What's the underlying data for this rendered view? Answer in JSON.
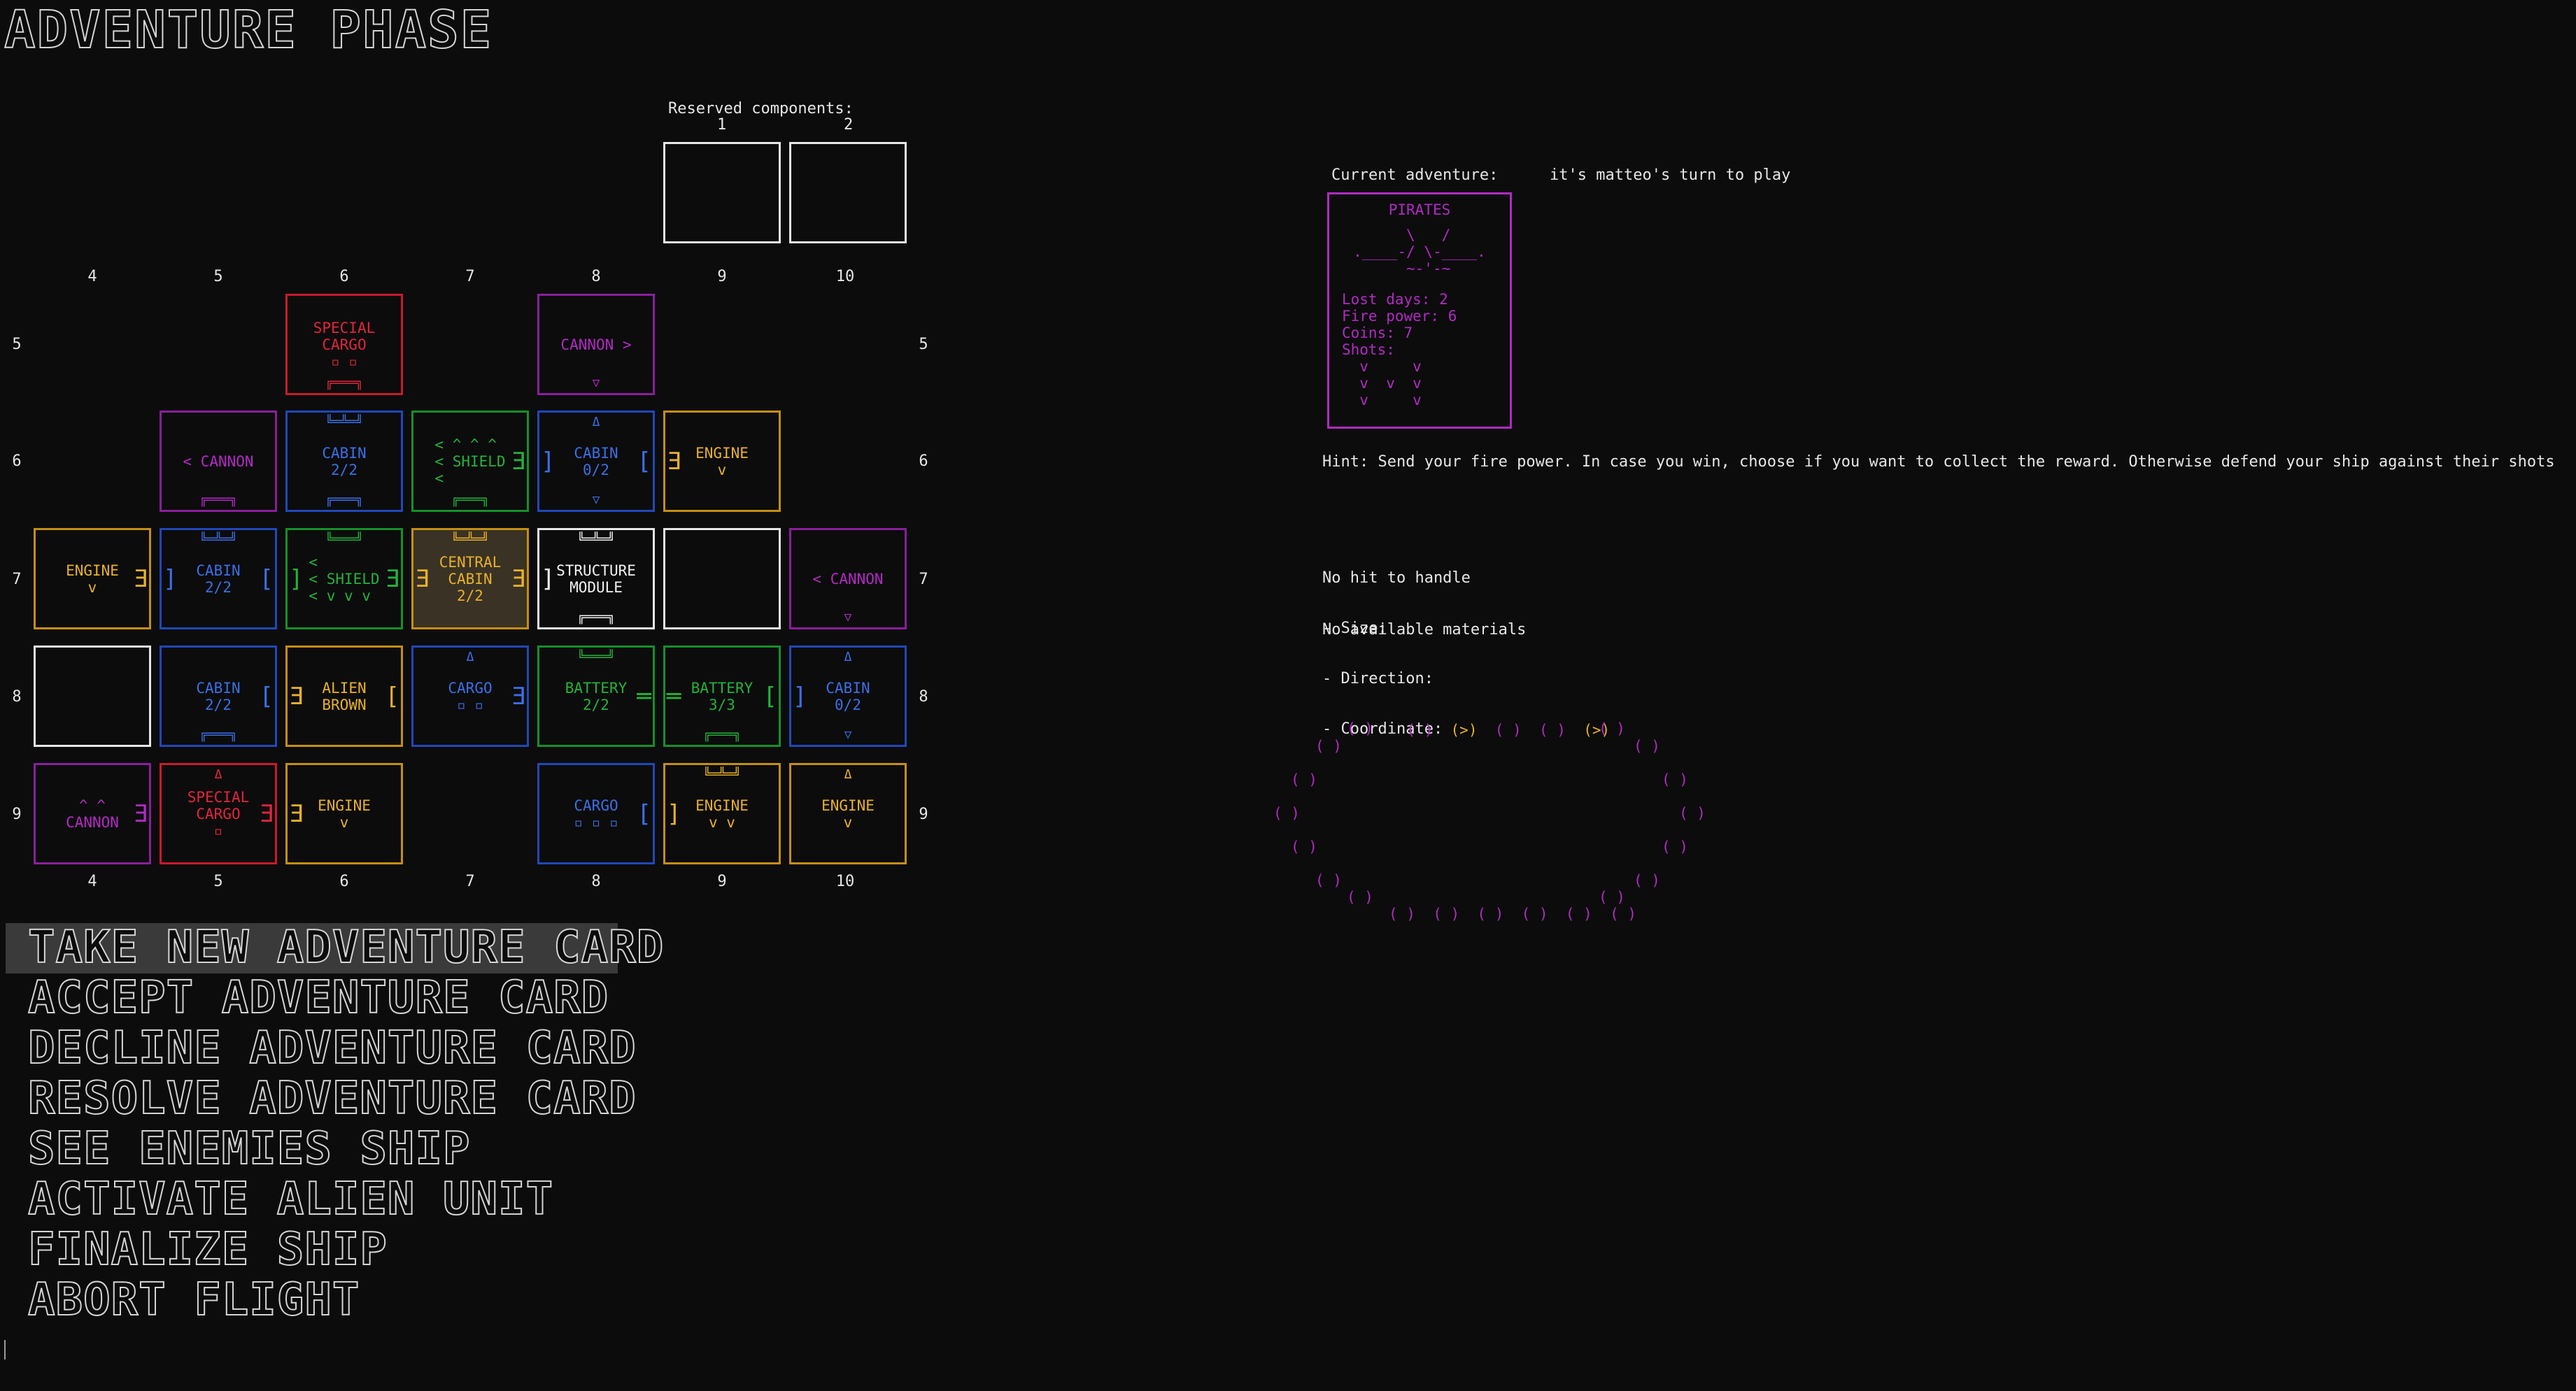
{
  "title": "ADVENTURE PHASE",
  "reserved": {
    "label": "Reserved components:",
    "slots": [
      "1",
      "2"
    ]
  },
  "grid": {
    "columns": [
      "4",
      "5",
      "6",
      "7",
      "8",
      "9",
      "10"
    ],
    "rows": [
      "5",
      "6",
      "7",
      "8",
      "9"
    ],
    "tiles": {
      "r5c6": {
        "lines": [
          "SPECIAL",
          "CARGO",
          "▫ ▫"
        ],
        "bot": "╔═══╗"
      },
      "r5c8": {
        "lines": [
          "CANNON >"
        ],
        "bot": "▽"
      },
      "r6c5": {
        "lines": [
          "< CANNON"
        ],
        "bot": "╔═══╗"
      },
      "r6c6": {
        "lines": [
          "CABIN",
          "2/2"
        ],
        "top": "╚═╩═╝",
        "bot": "╔═══╗"
      },
      "r6c7": {
        "lines": [
          "< ^ ^ ^",
          "< SHIELD",
          "<"
        ],
        "bot": "╔═══╗"
      },
      "r6c8": {
        "lines": [
          "CABIN",
          "0/2"
        ],
        "top": "Δ",
        "bot": "▽"
      },
      "r6c9": {
        "lines": [
          "ENGINE",
          "v"
        ]
      },
      "r7c4": {
        "lines": [
          "ENGINE",
          "v"
        ]
      },
      "r7c5": {
        "lines": [
          "CABIN",
          "2/2"
        ],
        "top": "╚═╩═╝"
      },
      "r7c6": {
        "lines": [
          "<",
          "< SHIELD",
          "< v v v"
        ],
        "top": "╚═══╝"
      },
      "r7c7": {
        "lines": [
          "CENTRAL",
          "CABIN",
          "2/2"
        ],
        "top": "╚═╩═╝"
      },
      "r7c8": {
        "lines": [
          "STRUCTURE",
          "MODULE"
        ],
        "top": "╚═╩═╝",
        "bot": "╔═══╗"
      },
      "r7c10": {
        "lines": [
          "< CANNON"
        ],
        "bot": "▽"
      },
      "r8c5": {
        "lines": [
          "CABIN",
          "2/2"
        ],
        "bot": "╔═══╗"
      },
      "r8c6": {
        "lines": [
          "ALIEN",
          "BROWN"
        ]
      },
      "r8c7": {
        "lines": [
          "CARGO",
          "▫ ▫"
        ],
        "top": "Δ"
      },
      "r8c8": {
        "lines": [
          "BATTERY",
          "2/2"
        ],
        "top": "╚═══╝"
      },
      "r8c9": {
        "lines": [
          "BATTERY",
          "3/3"
        ],
        "bot": "╔═══╗"
      },
      "r8c10": {
        "lines": [
          "CABIN",
          "0/2"
        ],
        "top": "Δ",
        "bot": "▽"
      },
      "r9c4": {
        "lines": [
          "^ ^",
          "CANNON"
        ]
      },
      "r9c5": {
        "lines": [
          "SPECIAL",
          "CARGO",
          "▫"
        ],
        "top": "Δ"
      },
      "r9c6": {
        "lines": [
          "ENGINE",
          "v"
        ]
      },
      "r9c8": {
        "lines": [
          "CARGO",
          "▫ ▫ ▫"
        ]
      },
      "r9c9": {
        "lines": [
          "ENGINE",
          "v v"
        ],
        "top": "╚═╩═╝"
      },
      "r9c10": {
        "lines": [
          "ENGINE",
          "v"
        ],
        "top": "Δ"
      }
    }
  },
  "adventure": {
    "current_label": "Current adventure:",
    "turn": "it's matteo's turn to play",
    "card_title": "PIRATES",
    "card_art": "  \\   /\n.____-/ \\-____.\n  ~-'-~",
    "stats": [
      "Lost days: 2",
      "Fire power: 6",
      "Coins: 7",
      "Shots:"
    ],
    "shots_art": "  v     v\n  v  v  v\n  v     v"
  },
  "hint": "Hint: Send your fire power. In case you win, choose if you want to collect the reward. Otherwise defend your ship against their shots",
  "hit_info": [
    "No hit to handle",
    "- Size:",
    "- Direction:",
    "- Coordinate:"
  ],
  "materials": "No available materials",
  "menu": [
    "TAKE NEW ADVENTURE CARD",
    "ACCEPT ADVENTURE CARD",
    "DECLINE ADVENTURE CARD",
    "RESOLVE ADVENTURE CARD",
    "SEE ENEMIES SHIP",
    "ACTIVATE ALIEN UNIT",
    "FINALIZE SHIP",
    "ABORT FLIGHT"
  ],
  "ring": {
    "top": [
      "( )",
      "(>)",
      "( )",
      "( )",
      "(>)"
    ],
    "highlight": "(>)"
  },
  "colors": {
    "red": "#e0263c",
    "purple": "#b22ac4",
    "blue": "#3b6fe6",
    "green": "#23b33a",
    "yellow": "#e8b12a",
    "white": "#f2f2f2"
  }
}
